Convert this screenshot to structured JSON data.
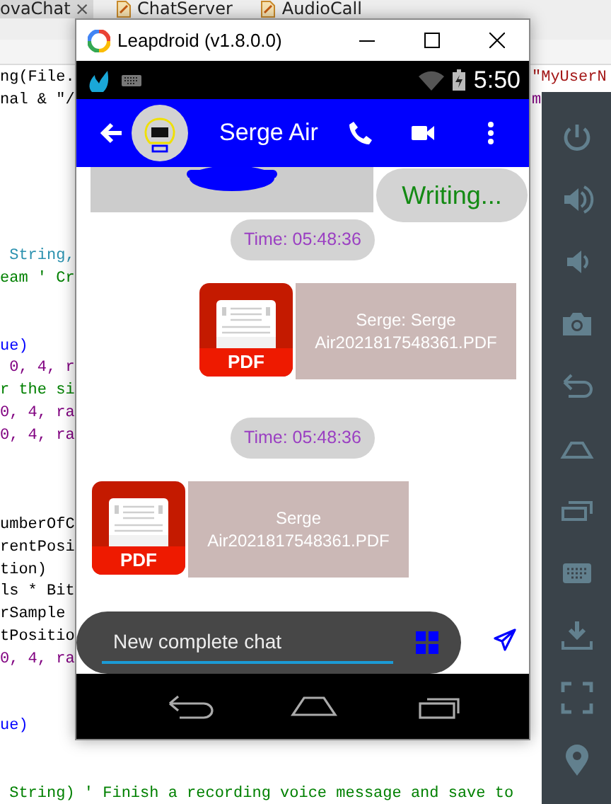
{
  "ide": {
    "tabs": [
      {
        "label": "ovaChat",
        "selected": true,
        "closable": true
      },
      {
        "label": "ChatServer",
        "selected": false,
        "closable": false
      },
      {
        "label": "AudioCall",
        "selected": false,
        "closable": false
      }
    ],
    "code_lines": [
      {
        "kind": "plain",
        "text": "ng(File.",
        "right": {
          "kind": "string",
          "text": "\"MyUserN"
        }
      },
      {
        "kind": "plain",
        "text": "nal & \"/",
        "right": {
          "kind": "number",
          "text": "m"
        }
      },
      {
        "kind": "blank"
      },
      {
        "kind": "blank"
      },
      {
        "kind": "blank"
      },
      {
        "kind": "blank"
      },
      {
        "kind": "blank"
      },
      {
        "kind": "blank"
      },
      {
        "kind": "type",
        "text": " String,"
      },
      {
        "kind": "comment",
        "text": "eam ' Cr"
      },
      {
        "kind": "blank"
      },
      {
        "kind": "blank"
      },
      {
        "kind": "keyword",
        "text": "ue)"
      },
      {
        "kind": "number",
        "text": " 0, 4, r"
      },
      {
        "kind": "comment",
        "text": "r the si"
      },
      {
        "kind": "number",
        "text": "0, 4, ra"
      },
      {
        "kind": "number",
        "text": "0, 4, ra"
      },
      {
        "kind": "blank"
      },
      {
        "kind": "blank"
      },
      {
        "kind": "blank"
      },
      {
        "kind": "plain",
        "text": "umberOfC"
      },
      {
        "kind": "plain",
        "text": "rentPosi"
      },
      {
        "kind": "plain",
        "text": "tion)"
      },
      {
        "kind": "plain",
        "text": "ls * Bit"
      },
      {
        "kind": "plain",
        "text": "rSample"
      },
      {
        "kind": "plain",
        "text": "tPositio"
      },
      {
        "kind": "number",
        "text": "0, 4, ra"
      },
      {
        "kind": "blank"
      },
      {
        "kind": "blank"
      },
      {
        "kind": "keyword",
        "text": "ue)"
      },
      {
        "kind": "blank"
      },
      {
        "kind": "blank"
      },
      {
        "kind": "comment",
        "text": " String) ' Finish a recording voice message and save to"
      }
    ]
  },
  "emulator": {
    "title": "Leapdroid (v1.8.0.0)",
    "status_bar": {
      "time": "5:50"
    },
    "app_bar": {
      "title": "Serge Air"
    },
    "top_row": {
      "typing": "Writing..."
    },
    "messages": [
      {
        "kind": "time",
        "text": "Time: 05:48:36"
      },
      {
        "kind": "file_sent",
        "badge": "PDF",
        "caption": "Serge: Serge Air2021817548361.PDF"
      },
      {
        "kind": "time",
        "text": "Time: 05:48:36"
      },
      {
        "kind": "file_received",
        "badge": "PDF",
        "caption": "Serge Air2021817548361.PDF"
      }
    ],
    "composer": {
      "value": "New complete chat"
    }
  }
}
